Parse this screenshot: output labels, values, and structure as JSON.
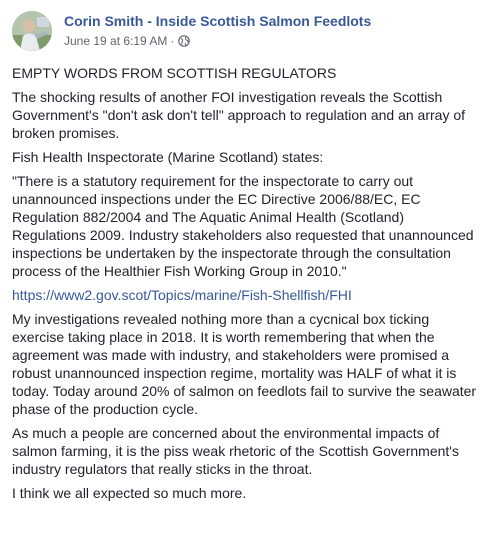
{
  "post": {
    "author": "Corin Smith - Inside Scottish Salmon Feedlots",
    "timestamp": "June 19 at 6:19 AM",
    "separator": "·",
    "privacy_icon": "globe-icon",
    "paragraphs": [
      "EMPTY WORDS FROM SCOTTISH REGULATORS",
      "The shocking results of another FOI investigation reveals the Scottish\nGovernment's \"don't ask don't tell\" approach to regulation and an array of\nbroken promises.",
      "Fish Health Inspectorate (Marine Scotland) states:",
      "\"There is a statutory requirement for the inspectorate to carry out\nunannounced inspections under the EC Directive 2006/88/EC, EC\nRegulation 882/2004 and The Aquatic Animal Health (Scotland)\nRegulations 2009. Industry stakeholders also requested that unannounced\ninspections be undertaken by the inspectorate through the consultation\nprocess of the Healthier Fish Working Group in 2010.\""
    ],
    "link": "https://www2.gov.scot/Topics/marine/Fish-Shellfish/FHI",
    "paragraphs_after_link": [
      "My investigations revealed nothing more than a cycnical box ticking\nexercise taking place in 2018. It is worth remembering that when the\nagreement was made with industry, and stakeholders were promised a\nrobust unannounced inspection regime, mortality was HALF of what it is\ntoday. Today around 20% of salmon on feedlots fail to survive the seawater\nphase of the production cycle.",
      "As much a people are concerned about the environmental impacts of\nsalmon farming, it is the piss weak rhetoric of the Scottish Government's\nindustry regulators that really sticks in the throat.",
      "I think we all expected so much more."
    ]
  },
  "colors": {
    "author_link": "#385898",
    "text": "#1d2129",
    "meta": "#616770",
    "link": "#365899"
  }
}
